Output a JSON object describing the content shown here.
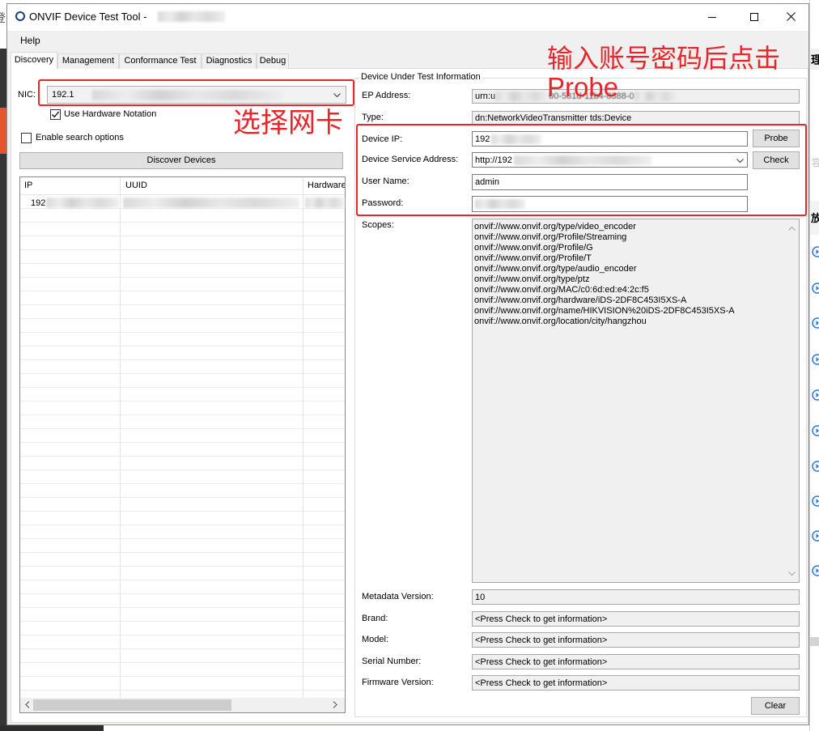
{
  "window": {
    "title": "ONVIF Device Test Tool -",
    "app_icon": "onvif-app-icon",
    "control_icons": [
      "minimize-icon",
      "maximize-icon",
      "close-icon"
    ]
  },
  "menu": {
    "items": [
      {
        "label": "Help"
      }
    ]
  },
  "tabs": [
    {
      "label": "Discovery",
      "selected": true
    },
    {
      "label": "Management",
      "selected": false
    },
    {
      "label": "Conformance Test",
      "selected": false
    },
    {
      "label": "Diagnostics",
      "selected": false
    },
    {
      "label": "Debug",
      "selected": false
    }
  ],
  "discovery": {
    "nic": {
      "label": "NIC:",
      "value": "192.1"
    },
    "use_hardware_notation": {
      "label": "Use Hardware Notation",
      "checked": true
    },
    "enable_search_options": {
      "label": "Enable search options",
      "checked": false
    },
    "discover_button": "Discover Devices",
    "device_list": {
      "columns": [
        "IP",
        "UUID",
        "Hardware"
      ],
      "rows": [
        {
          "ip": "192"
        }
      ]
    }
  },
  "dut": {
    "title": "Device Under Test Information",
    "ep_address": {
      "label": "EP Address:",
      "value_prefix": "urn:u",
      "value_fragment": "00-581d-11b4-8388-0"
    },
    "type": {
      "label": "Type:",
      "value": "dn:NetworkVideoTransmitter tds:Device"
    },
    "device_ip": {
      "label": "Device IP:",
      "value": "192"
    },
    "probe_button": "Probe",
    "service_address": {
      "label": "Device Service Address:",
      "value": "http://192"
    },
    "check_button": "Check",
    "user_name": {
      "label": "User Name:",
      "value": "admin"
    },
    "password": {
      "label": "Password:"
    },
    "scopes": {
      "label": "Scopes:",
      "values": [
        "onvif://www.onvif.org/type/video_encoder",
        "onvif://www.onvif.org/Profile/Streaming",
        "onvif://www.onvif.org/Profile/G",
        "onvif://www.onvif.org/Profile/T",
        "onvif://www.onvif.org/type/audio_encoder",
        "onvif://www.onvif.org/type/ptz",
        "onvif://www.onvif.org/MAC/c0:6d:ed:e4:2c:f5",
        "onvif://www.onvif.org/hardware/iDS-2DF8C453I5XS-A",
        "onvif://www.onvif.org/name/HIKVISION%20iDS-2DF8C453I5XS-A",
        "onvif://www.onvif.org/location/city/hangzhou"
      ]
    },
    "metadata_version": {
      "label": "Metadata Version:",
      "value": "10"
    },
    "brand": {
      "label": "Brand:",
      "value": "<Press Check to get information>"
    },
    "model": {
      "label": "Model:",
      "value": "<Press Check to get information>"
    },
    "serial_number": {
      "label": "Serial Number:",
      "value": "<Press Check to get information>"
    },
    "firmware_version": {
      "label": "Firmware Version:",
      "value": "<Press Check to get information>"
    },
    "clear_button": "Clear"
  },
  "annotations": {
    "select_nic": "选择网卡",
    "instruction_line1": "输入账号密码后点击",
    "instruction_line2": "Probe"
  },
  "background_windows": {
    "left_glyph": "登",
    "right_glyphs": [
      "理",
      "容",
      "放"
    ],
    "right_icon": "play-circle-icon"
  },
  "colors": {
    "annotation_red": "#e8262a",
    "accent_blue": "#2b78e4",
    "readonly_field_bg": "#f0f0f0"
  }
}
